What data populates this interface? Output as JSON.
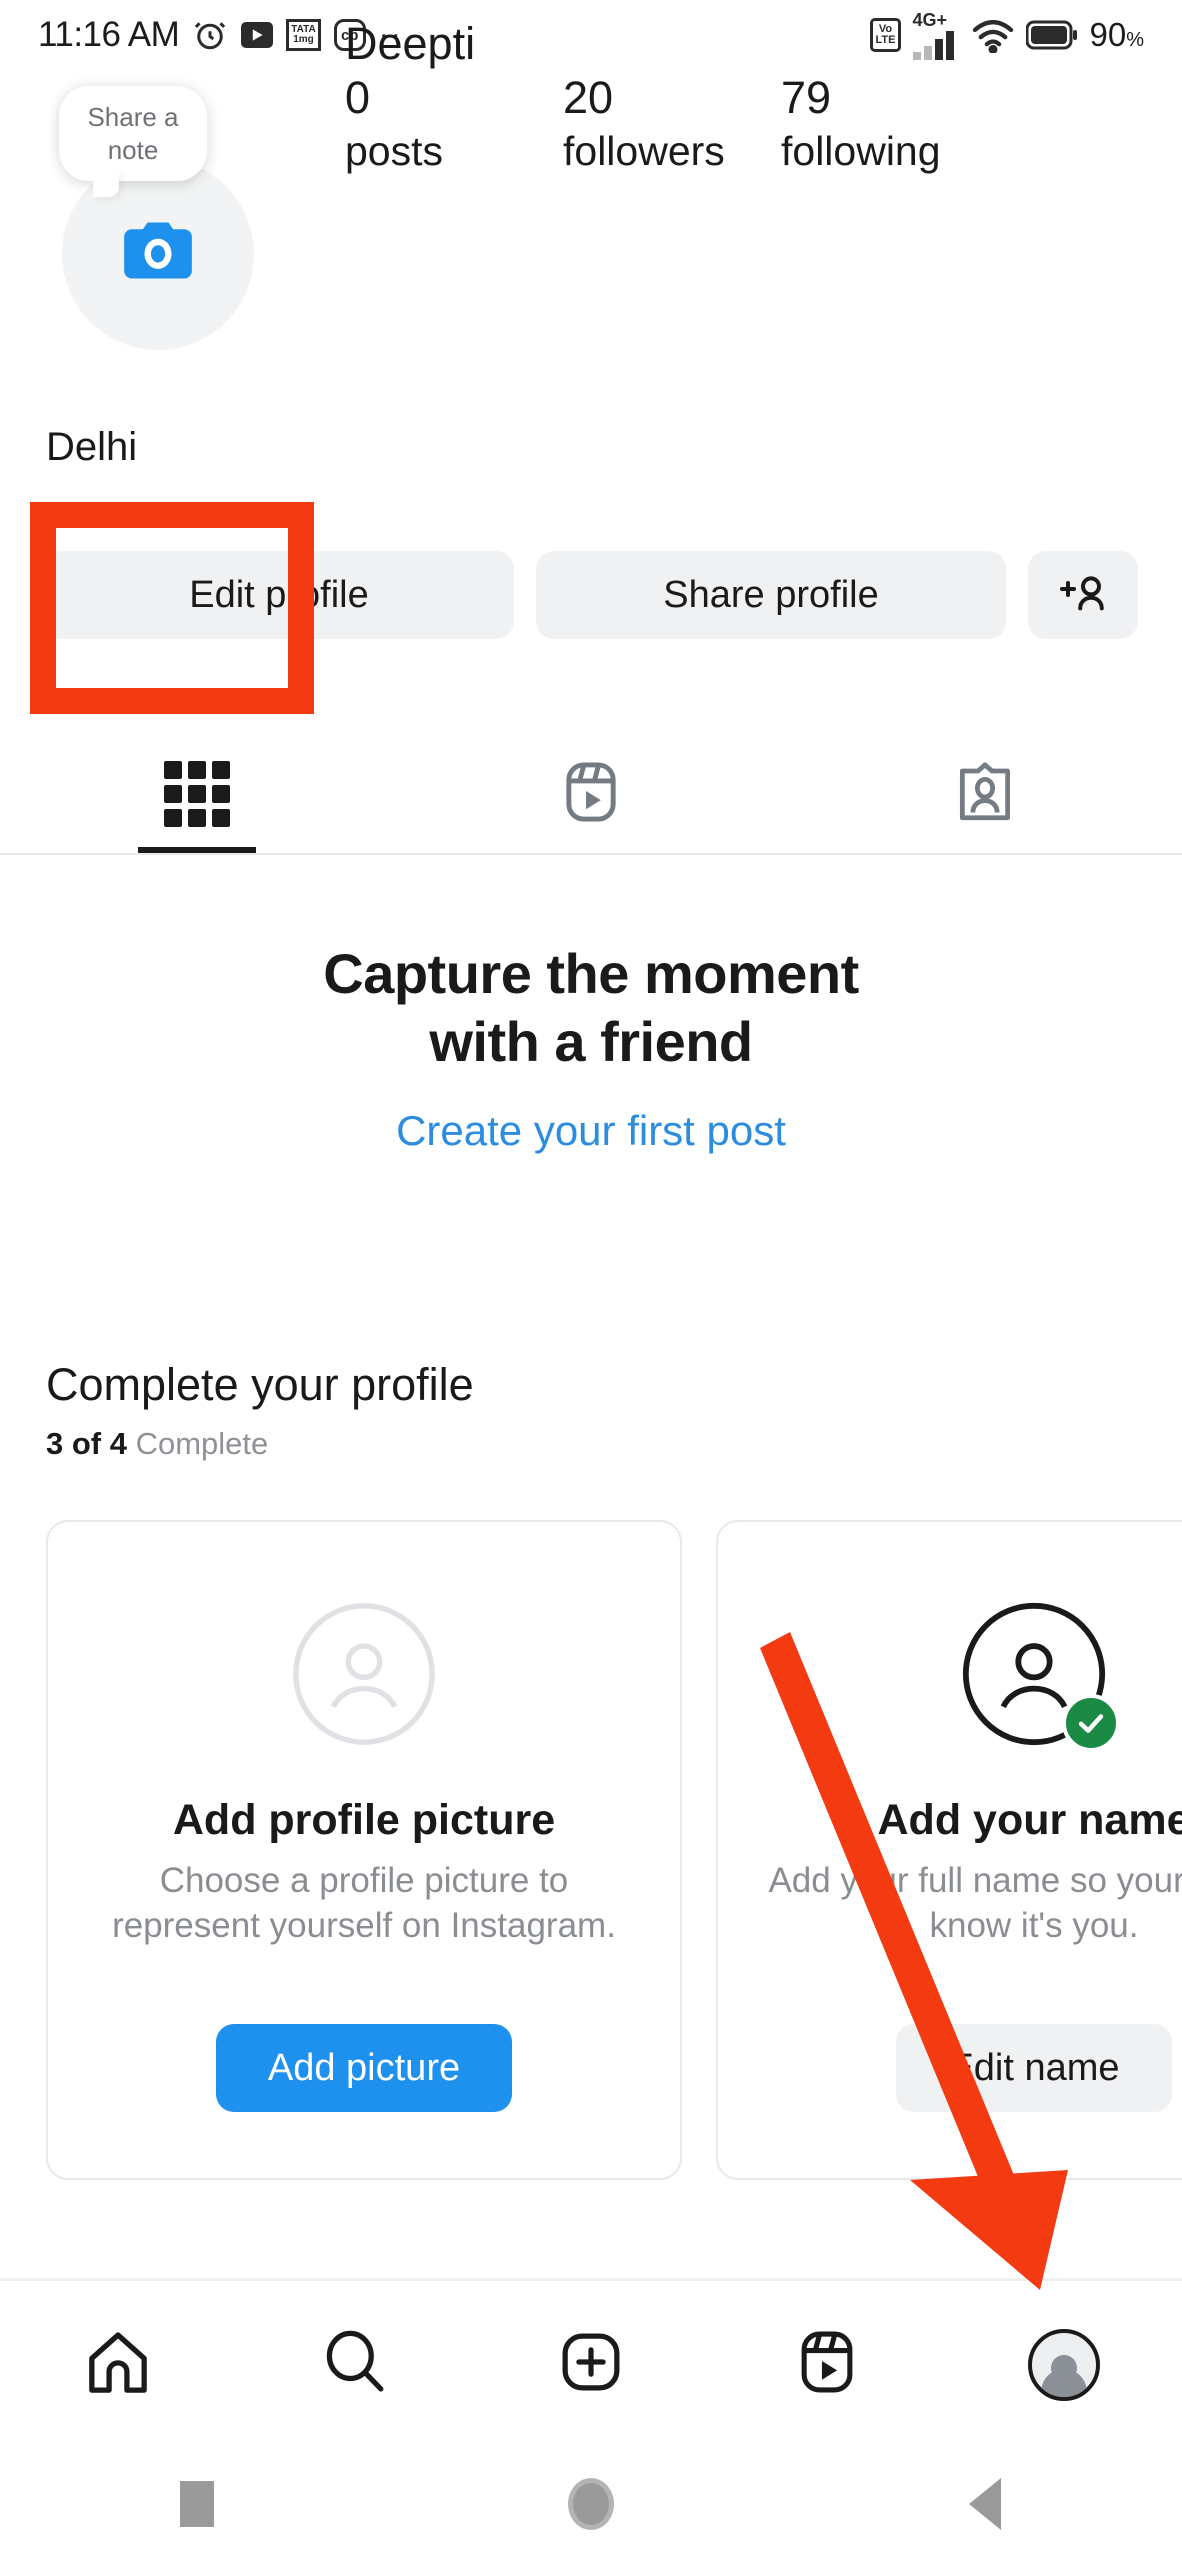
{
  "status_bar": {
    "time": "11:16 AM",
    "left_icons": [
      "alarm-icon",
      "youtube-icon",
      "tata-1mg-icon",
      "cb-icon",
      "more-dots-icon"
    ],
    "tata_line1": "TATA",
    "tata_line2": "1mg",
    "cb_label": "cb",
    "volte_line1": "Vo",
    "volte_line2": "LTE",
    "network_type": "4G+",
    "battery_percent": "90",
    "battery_percent_symbol": "%",
    "right_icons": [
      "volte-icon",
      "signal-icon",
      "wifi-icon",
      "battery-icon"
    ]
  },
  "profile": {
    "note_bubble_text": "Share a note",
    "display_name": "Deepti",
    "bio_location": "Delhi",
    "avatar_icon": "camera-icon",
    "stats": [
      {
        "value": "0",
        "label": "posts"
      },
      {
        "value": "20",
        "label": "followers"
      },
      {
        "value": "79",
        "label": "following"
      }
    ]
  },
  "actions": {
    "edit_profile_label": "Edit profile",
    "share_profile_label": "Share profile",
    "add_person_icon": "add-person-icon"
  },
  "tabs": [
    {
      "name": "grid-tab",
      "icon": "grid-icon",
      "active": true
    },
    {
      "name": "reels-tab",
      "icon": "reels-icon",
      "active": false
    },
    {
      "name": "tagged-tab",
      "icon": "tagged-icon",
      "active": false
    }
  ],
  "empty_state": {
    "title_line1": "Capture the moment",
    "title_line2": "with a friend",
    "cta_label": "Create your first post"
  },
  "complete_profile": {
    "heading": "Complete your profile",
    "progress_bold": "3 of 4",
    "progress_rest": "Complete",
    "cards": [
      {
        "id": "add-profile-picture",
        "title": "Add profile picture",
        "description": "Choose a profile picture to represent yourself on Instagram.",
        "button_label": "Add picture",
        "button_style": "primary",
        "completed": false,
        "illustration": "avatar-placeholder-icon"
      },
      {
        "id": "add-your-name",
        "title": "Add your name",
        "description": "Add your full name so your friends know it's you.",
        "button_label": "Edit name",
        "button_style": "secondary",
        "completed": true,
        "illustration": "avatar-check-icon"
      }
    ]
  },
  "bottom_nav": [
    {
      "name": "nav-home",
      "icon": "home-icon"
    },
    {
      "name": "nav-search",
      "icon": "search-icon"
    },
    {
      "name": "nav-create",
      "icon": "plus-square-icon"
    },
    {
      "name": "nav-reels",
      "icon": "reels-icon"
    },
    {
      "name": "nav-profile",
      "icon": "profile-avatar-icon"
    }
  ],
  "system_nav": [
    {
      "name": "sys-recents",
      "icon": "square-icon"
    },
    {
      "name": "sys-home",
      "icon": "circle-icon"
    },
    {
      "name": "sys-back",
      "icon": "back-triangle-icon"
    }
  ],
  "annotations": {
    "highlight_color": "#f33a10",
    "arrow_color": "#f33a10",
    "highlight_target": "edit-profile-button",
    "arrow_target": "nav-profile"
  },
  "colors": {
    "accent_blue": "#1e90ed",
    "link_blue": "#2b8ce0",
    "pill_grey": "#f0f1f3",
    "text_primary": "#1a1a1a",
    "text_secondary": "#8a8d91",
    "check_green": "#1a8a45"
  }
}
